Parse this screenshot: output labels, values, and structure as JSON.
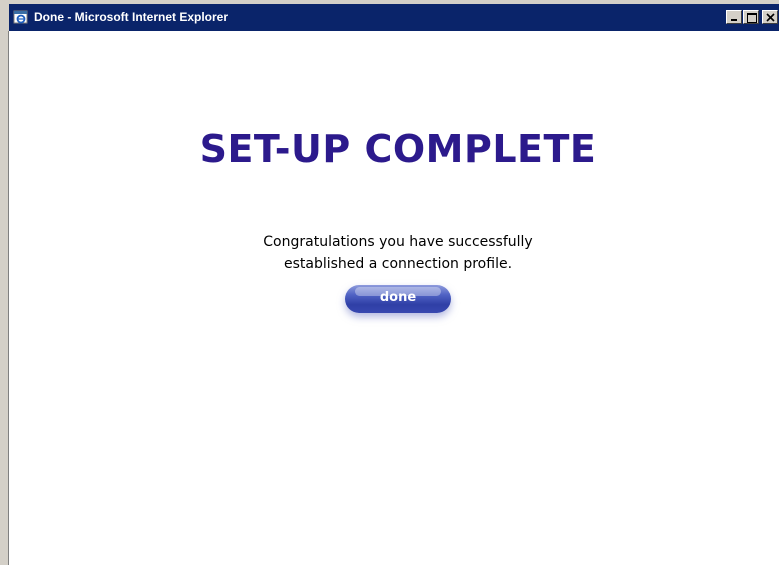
{
  "window": {
    "title": "Done - Microsoft Internet Explorer",
    "icon": "ie-icon",
    "controls": [
      "minimize-icon",
      "maximize-icon",
      "close-icon"
    ]
  },
  "page": {
    "heading": "SET-UP COMPLETE",
    "message_line1": "Congratulations you have successfully",
    "message_line2": "established a connection profile.",
    "done_label": "done"
  },
  "colors": {
    "titlebar": "#0a246a",
    "heading": "#2c1a8c",
    "button": "#3848b0"
  }
}
